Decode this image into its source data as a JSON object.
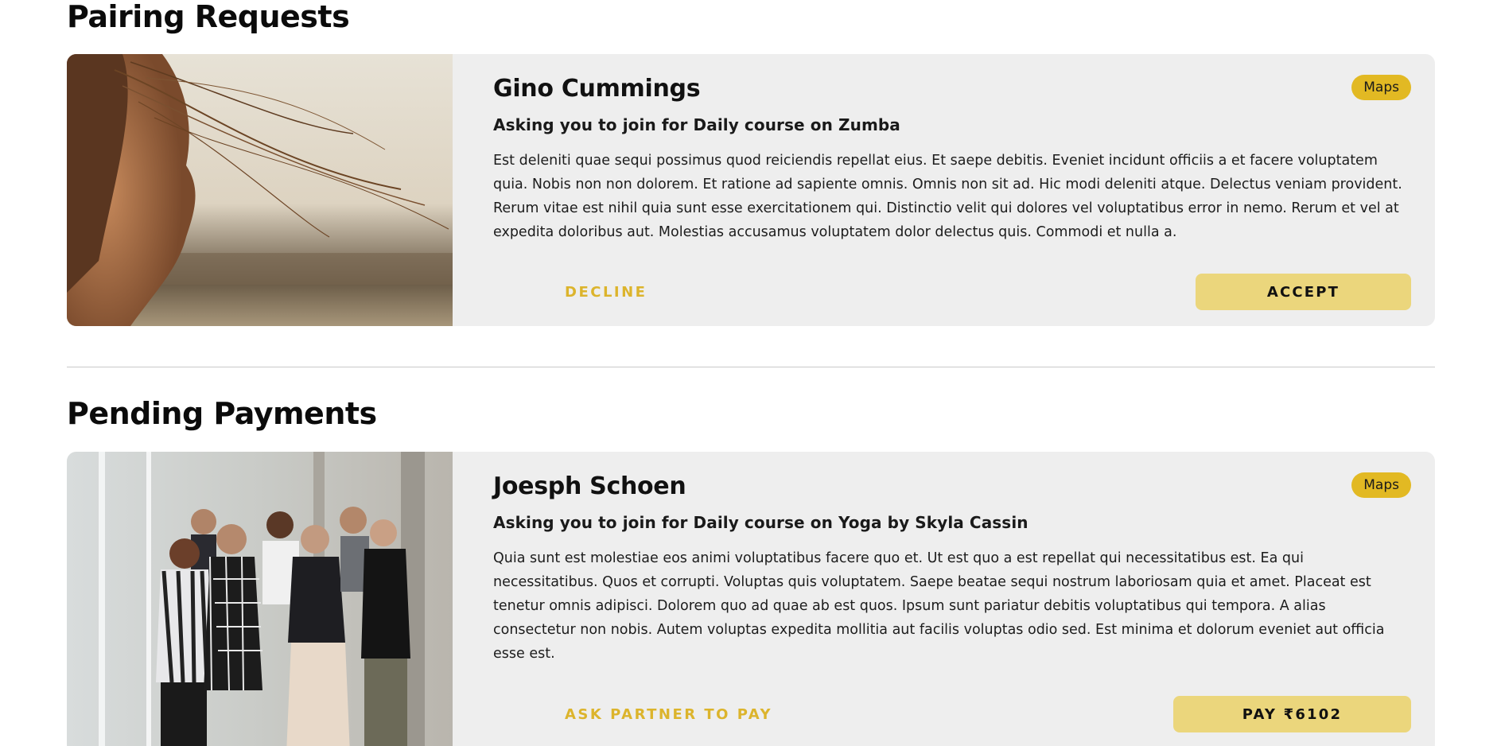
{
  "sections": {
    "pairing_title": "Pairing Requests",
    "pending_title": "Pending Payments"
  },
  "pairing_request": {
    "name": "Gino Cummings",
    "badge": "Maps",
    "subtitle": "Asking you to join for Daily course on Zumba",
    "description": "Est deleniti quae sequi possimus quod reiciendis repellat eius. Et saepe debitis. Eveniet incidunt officiis a et facere voluptatem quia. Nobis non non dolorem. Et ratione ad sapiente omnis. Omnis non sit ad. Hic modi deleniti atque. Delectus veniam provident. Rerum vitae est nihil quia sunt esse exercitationem qui. Distinctio velit qui dolores vel voluptatibus error in nemo. Rerum et vel at expedita doloribus aut. Molestias accusamus voluptatem dolor delectus quis. Commodi et nulla a.",
    "decline_label": "DECLINE",
    "accept_label": "ACCEPT"
  },
  "pending_payment": {
    "name": "Joesph Schoen",
    "badge": "Maps",
    "subtitle": "Asking you to join for Daily course on Yoga by Skyla Cassin",
    "description": "Quia sunt est molestiae eos animi voluptatibus facere quo et. Ut est quo a est repellat qui necessitatibus est. Ea qui necessitatibus. Quos et corrupti. Voluptas quis voluptatem. Saepe beatae sequi nostrum laboriosam quia et amet. Placeat est tenetur omnis adipisci. Dolorem quo ad quae ab est quos. Ipsum sunt pariatur debitis voluptatibus qui tempora. A alias consectetur non nobis. Autem voluptas expedita mollitia aut facilis voluptas odio sed. Est minima et dolorum eveniet aut officia esse est.",
    "ask_partner_label": "ASK PARTNER TO PAY",
    "pay_label": "PAY ₹6102"
  },
  "colors": {
    "badge_bg": "#e2b923",
    "accent_text": "#dcb42c",
    "button_fill": "#ebd67c",
    "card_bg": "#eeeeee"
  }
}
